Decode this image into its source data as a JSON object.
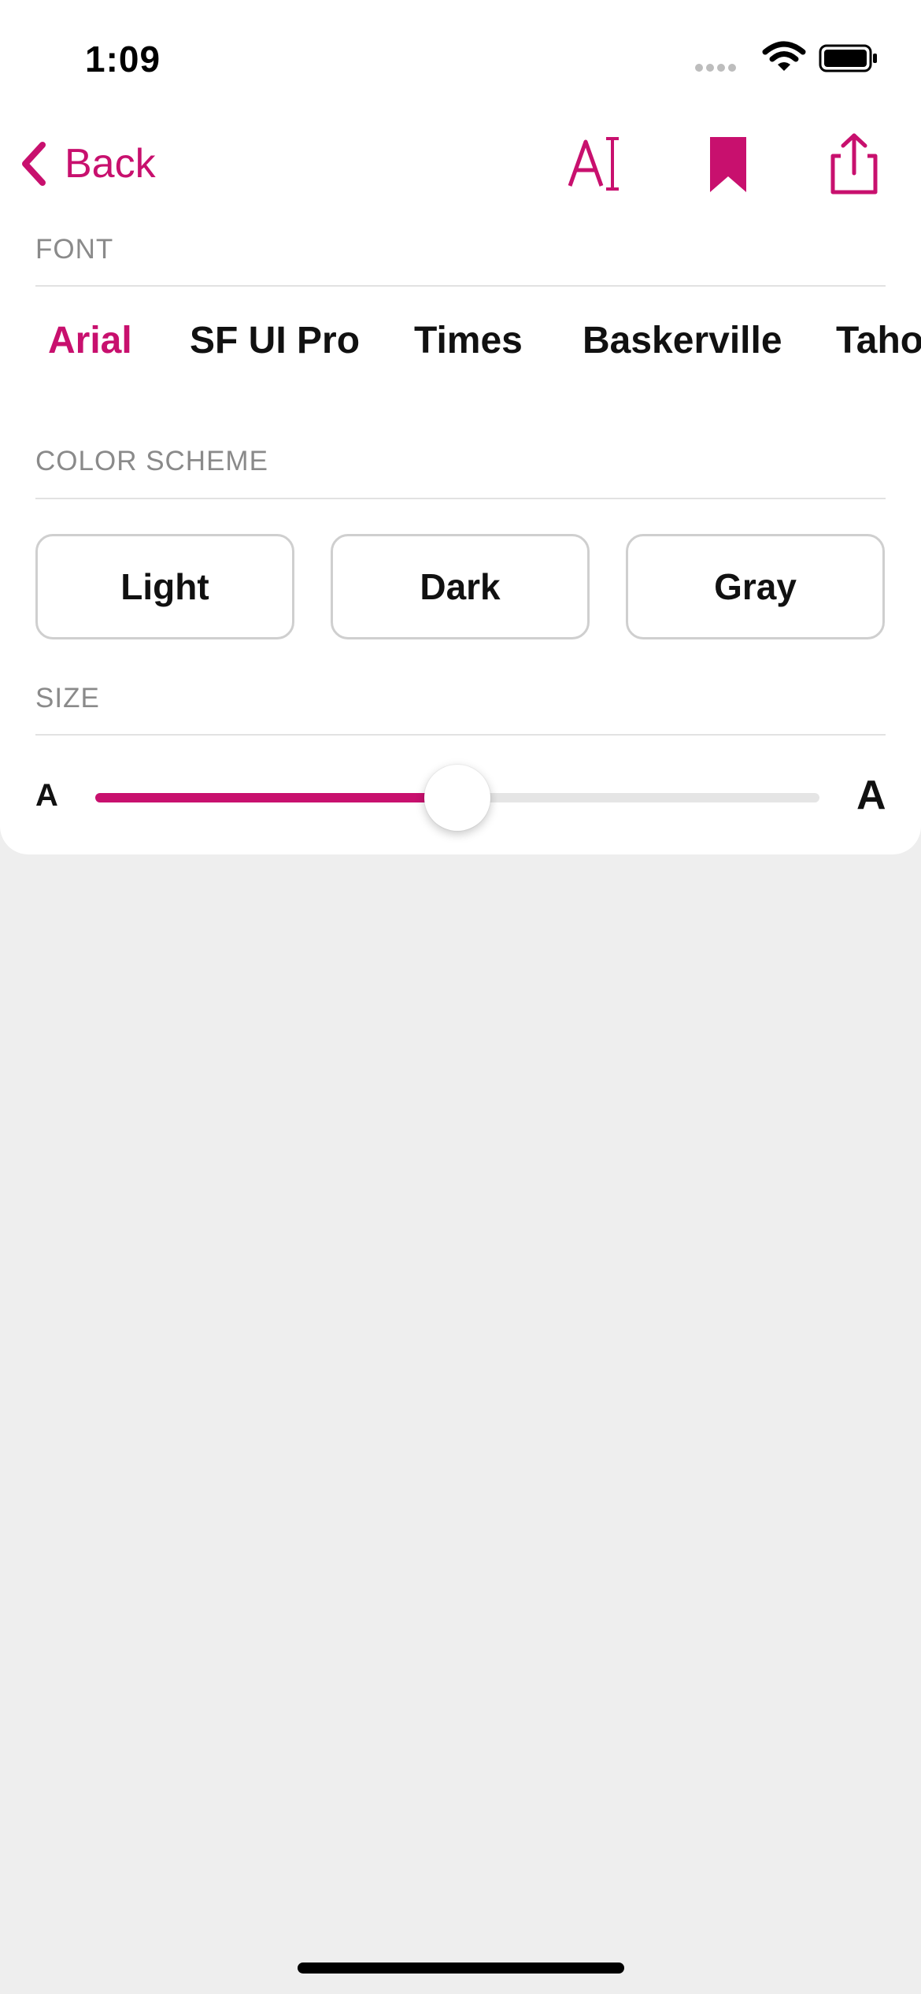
{
  "status_bar": {
    "time": "1:09",
    "icons": [
      "signal-icon",
      "wifi-icon",
      "battery-icon"
    ]
  },
  "nav": {
    "back_label": "Back",
    "icons": [
      "chevron-left-icon",
      "font-size-icon",
      "bookmark-icon",
      "share-icon"
    ]
  },
  "font_section": {
    "header": "FONT",
    "options": [
      "Arial",
      "SF UI Pro",
      "Times",
      "Baskerville",
      "Taho"
    ],
    "selected": "Arial"
  },
  "color_scheme_section": {
    "header": "COLOR SCHEME",
    "options": [
      "Light",
      "Dark",
      "Gray"
    ]
  },
  "size_section": {
    "header": "SIZE",
    "small_label": "A",
    "large_label": "A",
    "value": 0.5
  },
  "colors": {
    "accent": "#C8106E",
    "background": "#EEEEEE",
    "panel": "#FFFFFF",
    "muted_text": "#8A8A8A"
  }
}
